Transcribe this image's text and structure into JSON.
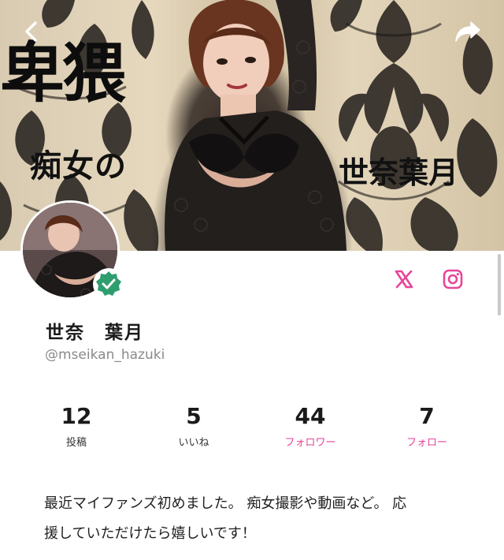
{
  "cover": {
    "title_big": "卑猥",
    "title_sub": "痴女の",
    "title_name": "世奈葉月"
  },
  "nav": {
    "back_icon": "chevron-left-icon",
    "share_icon": "share-arrow-icon"
  },
  "profile": {
    "display_name": "世奈　葉月",
    "handle": "@mseikan_hazuki",
    "verified_icon": "verified-check-icon",
    "social": [
      "x-icon",
      "instagram-icon"
    ]
  },
  "stats": [
    {
      "value": "12",
      "label": "投稿"
    },
    {
      "value": "5",
      "label": "いいね"
    },
    {
      "value": "44",
      "label": "フォロワー"
    },
    {
      "value": "7",
      "label": "フォロー"
    }
  ],
  "bio": {
    "line1": "最近マイファンズ初めました。 痴女撮影や動画など。 応",
    "line2": "援していただけたら嬉しいです！"
  },
  "colors": {
    "accent_pink": "#e6469a",
    "verified_green": "#2f9e6e",
    "handle_gray": "#8a8a8a"
  }
}
